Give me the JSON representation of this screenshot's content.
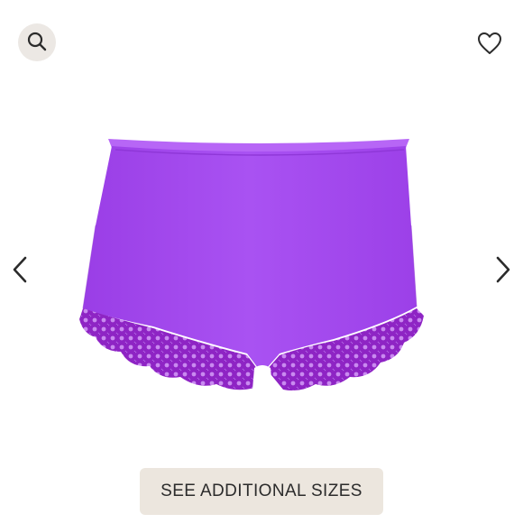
{
  "gallery": {
    "icons": {
      "zoom": "search-icon",
      "favorite": "heart-icon",
      "prev": "chevron-left-icon",
      "next": "chevron-right-icon"
    },
    "product_colors": {
      "fabric": "#a64cf0",
      "lace": "#8a1fbf"
    }
  },
  "actions": {
    "see_sizes_label": "SEE ADDITIONAL SIZES"
  },
  "colors": {
    "icon_button_bg": "#ece8e4",
    "sizes_button_bg": "#ece6de",
    "text": "#2b2b2b"
  }
}
